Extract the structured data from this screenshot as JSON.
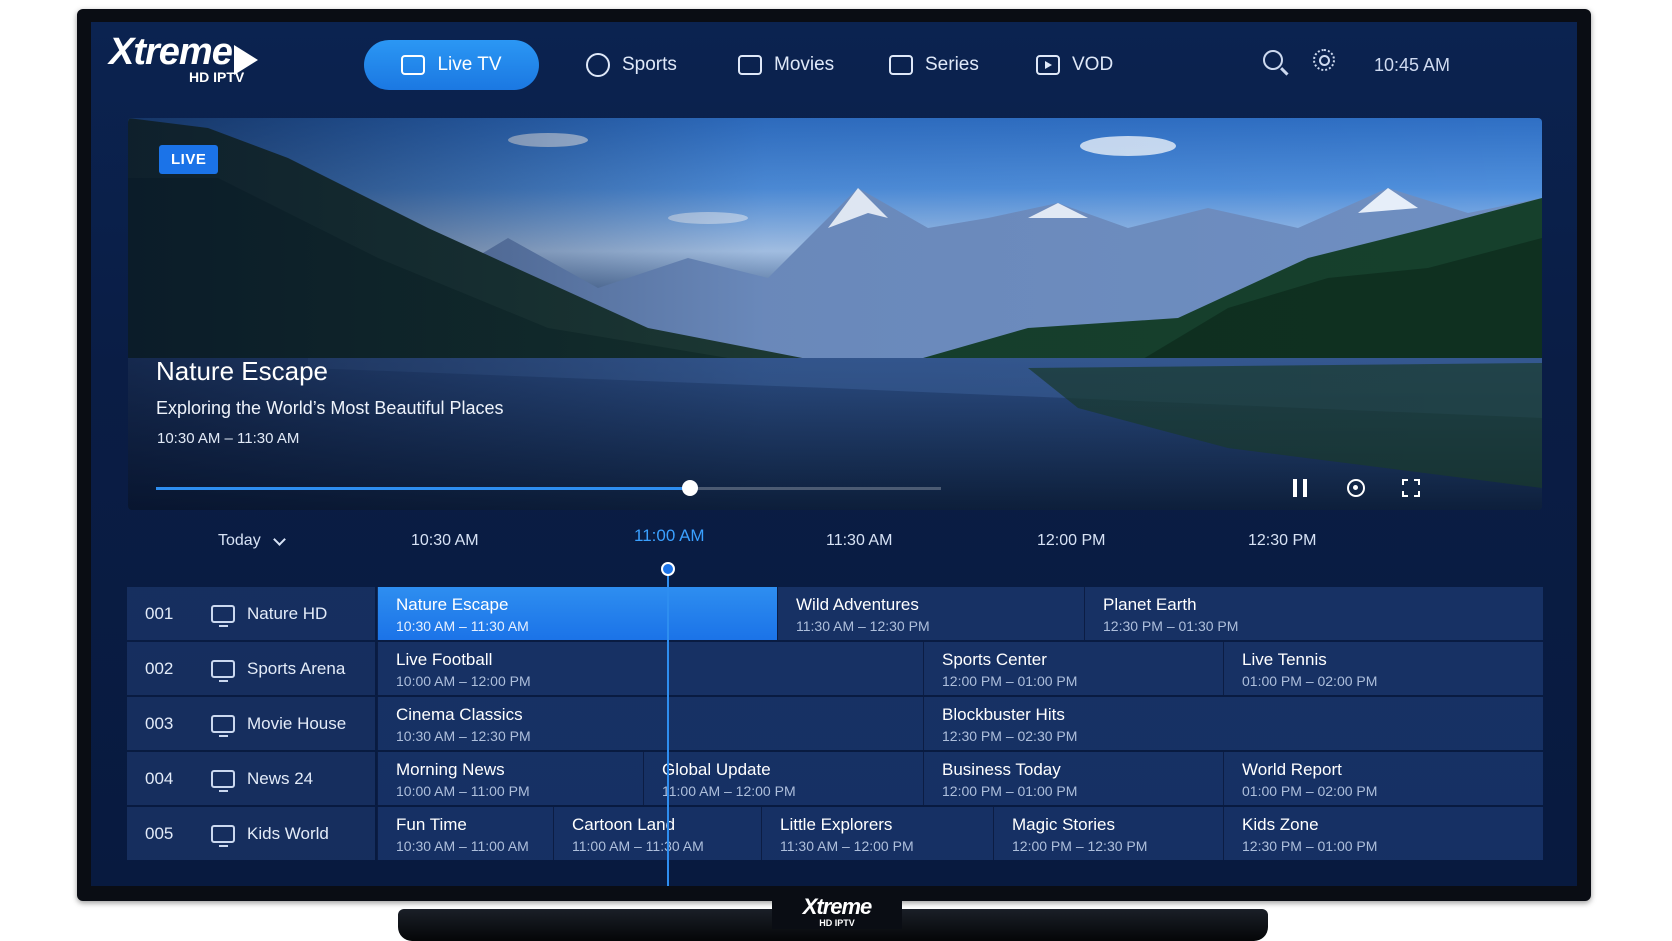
{
  "brand": {
    "name": "Xtreme",
    "sub": "HD IPTV"
  },
  "nav": {
    "items": [
      {
        "label": "Live TV",
        "icon": "tv-icon",
        "active": true
      },
      {
        "label": "Sports",
        "icon": "soccer-ball-icon",
        "active": false
      },
      {
        "label": "Movies",
        "icon": "film-icon",
        "active": false
      },
      {
        "label": "Series",
        "icon": "monitor-icon",
        "active": false
      },
      {
        "label": "VOD",
        "icon": "play-icon",
        "active": false
      }
    ],
    "clock": "10:45 AM"
  },
  "hero": {
    "badge": "LIVE",
    "title": "Nature Escape",
    "subtitle": "Exploring the World’s Most Beautiful Places",
    "time": "10:30 AM – 11:30 AM",
    "progress": 0.68
  },
  "guide": {
    "day": "Today",
    "times": [
      "10:30 AM",
      "11:00 AM",
      "11:30 AM",
      "12:00 PM",
      "12:30 PM"
    ],
    "current_time": "11:00 AM",
    "channels": [
      {
        "number": "001",
        "name": "Nature HD",
        "programs": [
          {
            "title": "Nature Escape",
            "time": "10:30 AM – 11:30 AM",
            "selected": true
          },
          {
            "title": "Wild Adventures",
            "time": "11:30 AM – 12:30 PM"
          },
          {
            "title": "Planet Earth",
            "time": "12:30 PM – 01:30 PM"
          }
        ]
      },
      {
        "number": "002",
        "name": "Sports Arena",
        "programs": [
          {
            "title": "Live Football",
            "time": "10:00 AM – 12:00 PM"
          },
          {
            "title": "Sports Center",
            "time": "12:00 PM – 01:00 PM"
          },
          {
            "title": "Live Tennis",
            "time": "01:00 PM – 02:00 PM"
          }
        ]
      },
      {
        "number": "003",
        "name": "Movie House",
        "programs": [
          {
            "title": "Cinema Classics",
            "time": "10:30 AM – 12:30 PM"
          },
          {
            "title": "Blockbuster Hits",
            "time": "12:30 PM – 02:30 PM"
          }
        ]
      },
      {
        "number": "004",
        "name": "News 24",
        "programs": [
          {
            "title": "Morning News",
            "time": "10:00 AM – 11:00 PM"
          },
          {
            "title": "Global Update",
            "time": "11:00 AM – 12:00 PM"
          },
          {
            "title": "Business Today",
            "time": "12:00 PM – 01:00 PM"
          },
          {
            "title": "World Report",
            "time": "01:00 PM – 02:00 PM"
          }
        ]
      },
      {
        "number": "005",
        "name": "Kids World",
        "programs": [
          {
            "title": "Fun Time",
            "time": "10:30 AM – 11:00 AM"
          },
          {
            "title": "Cartoon Land",
            "time": "11:00 AM – 11:30 AM"
          },
          {
            "title": "Little Explorers",
            "time": "11:30 AM – 12:00 PM"
          },
          {
            "title": "Magic Stories",
            "time": "12:00 PM – 12:30 PM"
          },
          {
            "title": "Kids Zone",
            "time": "12:30 PM – 01:00 PM"
          }
        ]
      }
    ]
  },
  "colors": {
    "accent": "#1b73e8",
    "background": "#0a1d45"
  }
}
